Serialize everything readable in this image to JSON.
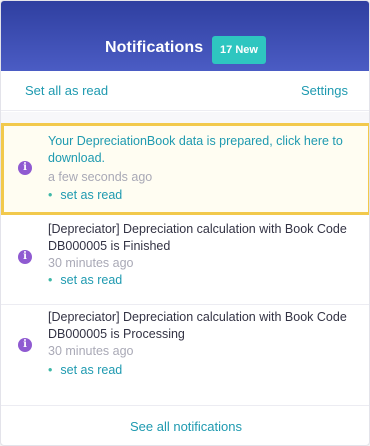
{
  "header": {
    "title": "Notifications",
    "new_badge": "17 New"
  },
  "actions": {
    "set_all_read": "Set all as read",
    "settings": "Settings"
  },
  "notifications": [
    {
      "message": "Your DepreciationBook data is prepared, click here to download.",
      "time": "a few seconds ago",
      "set_read": "set as read",
      "highlighted": true,
      "icon": "info-icon"
    },
    {
      "message": "[Depreciator] Depreciation calculation with Book Code DB000005 is Finished",
      "time": "30 minutes ago",
      "set_read": "set as read",
      "highlighted": false,
      "icon": "info-icon"
    },
    {
      "message": "[Depreciator] Depreciation calculation with Book Code DB000005 is Processing",
      "time": "30 minutes ago",
      "set_read": "set as read",
      "highlighted": false,
      "icon": "info-icon"
    }
  ],
  "footer": {
    "see_all": "See all notifications"
  },
  "colors": {
    "header_top": "#2f3fa0",
    "header_bottom": "#4b5cc4",
    "badge": "#2ec6c0",
    "link": "#1f9ab0",
    "info_icon": "#8f5ad1",
    "highlight_border": "#f2c94c"
  }
}
